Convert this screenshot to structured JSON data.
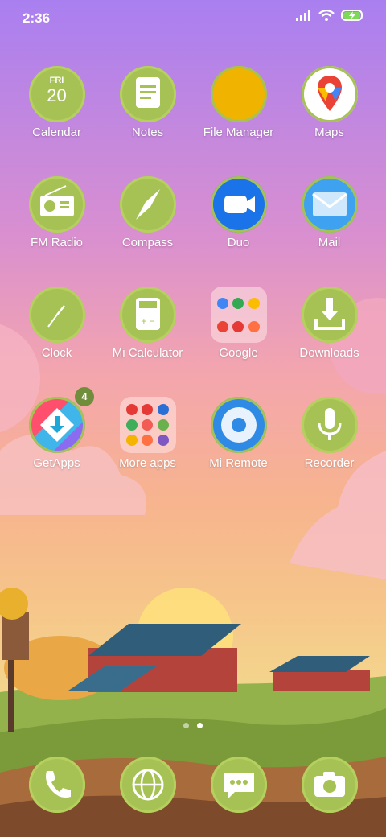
{
  "status": {
    "time": "2:36"
  },
  "apps": [
    {
      "label": "Calendar",
      "icon": "calendar-icon",
      "day": "FRI",
      "date": "20"
    },
    {
      "label": "Notes",
      "icon": "notes-icon"
    },
    {
      "label": "File Manager",
      "icon": "folder-icon"
    },
    {
      "label": "Maps",
      "icon": "maps-pin-icon"
    },
    {
      "label": "FM Radio",
      "icon": "radio-icon"
    },
    {
      "label": "Compass",
      "icon": "compass-icon"
    },
    {
      "label": "Duo",
      "icon": "video-camera-icon"
    },
    {
      "label": "Mail",
      "icon": "envelope-icon"
    },
    {
      "label": "Clock",
      "icon": "clock-icon"
    },
    {
      "label": "Mi Calculator",
      "icon": "calculator-icon"
    },
    {
      "label": "Google",
      "icon": "google-folder-icon"
    },
    {
      "label": "Downloads",
      "icon": "download-icon"
    },
    {
      "label": "GetApps",
      "icon": "getapps-icon",
      "badge": "4"
    },
    {
      "label": "More apps",
      "icon": "more-apps-folder-icon"
    },
    {
      "label": "Mi Remote",
      "icon": "remote-icon"
    },
    {
      "label": "Recorder",
      "icon": "microphone-icon"
    }
  ],
  "dock": [
    {
      "icon": "phone-icon"
    },
    {
      "icon": "globe-icon"
    },
    {
      "icon": "messages-icon"
    },
    {
      "icon": "camera-icon"
    }
  ],
  "pages": {
    "count": 2,
    "current": 2
  }
}
